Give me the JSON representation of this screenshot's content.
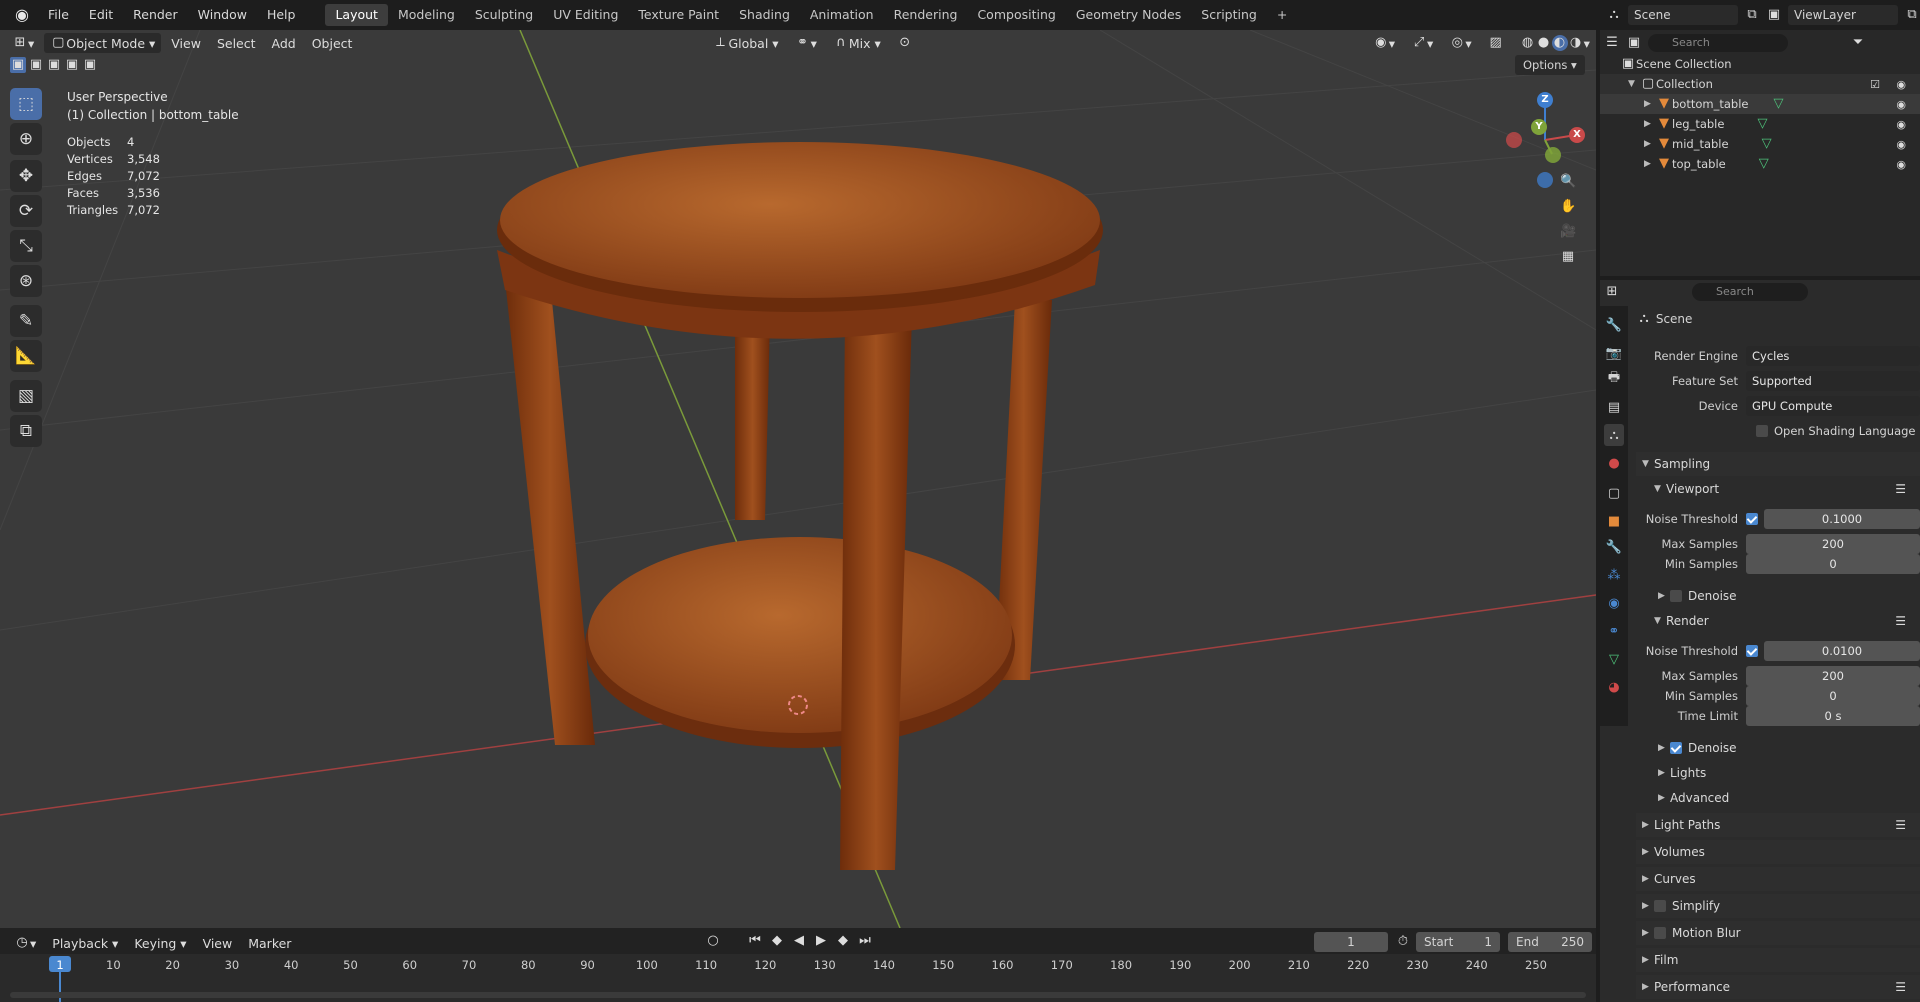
{
  "menu": [
    "File",
    "Edit",
    "Render",
    "Window",
    "Help"
  ],
  "workspaces": [
    "Layout",
    "Modeling",
    "Sculpting",
    "UV Editing",
    "Texture Paint",
    "Shading",
    "Animation",
    "Rendering",
    "Compositing",
    "Geometry Nodes",
    "Scripting"
  ],
  "active_workspace": "Layout",
  "add_tab_icon": "plus-icon",
  "scene_name": "Scene",
  "view_layer": "ViewLayer",
  "viewport_header": {
    "mode": "Object Mode",
    "menus": [
      "View",
      "Select",
      "Add",
      "Object"
    ],
    "transform": "Global",
    "snap": "Mix",
    "options": "Options"
  },
  "viewport_info": {
    "perspective": "User Perspective",
    "collection": "(1) Collection | bottom_table",
    "stats": [
      {
        "k": "Objects",
        "v": "4"
      },
      {
        "k": "Vertices",
        "v": "3,548"
      },
      {
        "k": "Edges",
        "v": "7,072"
      },
      {
        "k": "Faces",
        "v": "3,536"
      },
      {
        "k": "Triangles",
        "v": "7,072"
      }
    ]
  },
  "gizmo": {
    "x": "X",
    "y": "Y",
    "z": "Z"
  },
  "outliner": {
    "search_placeholder": "Search",
    "root": "Scene Collection",
    "collection": "Collection",
    "objects": [
      "bottom_table",
      "leg_table",
      "mid_table",
      "top_table"
    ]
  },
  "properties": {
    "search_placeholder": "Search",
    "context": "Scene",
    "render_engine": {
      "label": "Render Engine",
      "value": "Cycles"
    },
    "feature_set": {
      "label": "Feature Set",
      "value": "Supported"
    },
    "device": {
      "label": "Device",
      "value": "GPU Compute"
    },
    "osl": "Open Shading Language",
    "sampling": "Sampling",
    "viewport": {
      "title": "Viewport",
      "noise_threshold_label": "Noise Threshold",
      "noise_threshold": "0.1000",
      "max_samples_label": "Max Samples",
      "max_samples": "200",
      "min_samples_label": "Min Samples",
      "min_samples": "0",
      "denoise": "Denoise"
    },
    "render": {
      "title": "Render",
      "noise_threshold_label": "Noise Threshold",
      "noise_threshold": "0.0100",
      "max_samples_label": "Max Samples",
      "max_samples": "200",
      "min_samples_label": "Min Samples",
      "min_samples": "0",
      "time_limit_label": "Time Limit",
      "time_limit": "0 s",
      "denoise": "Denoise"
    },
    "lights": "Lights",
    "advanced": "Advanced",
    "panels": [
      "Light Paths",
      "Volumes",
      "Curves",
      "Simplify",
      "Motion Blur",
      "Film",
      "Performance"
    ]
  },
  "timeline": {
    "menus": [
      "Playback",
      "Keying",
      "View",
      "Marker"
    ],
    "current_frame": "1",
    "start_label": "Start",
    "start": "1",
    "end_label": "End",
    "end": "250",
    "ticks": [
      "1",
      "10",
      "20",
      "30",
      "40",
      "50",
      "60",
      "70",
      "80",
      "90",
      "100",
      "110",
      "120",
      "130",
      "140",
      "150",
      "160",
      "170",
      "180",
      "190",
      "200",
      "210",
      "220",
      "230",
      "240",
      "250"
    ]
  },
  "colors": {
    "accent": "#4a88d0",
    "wood": "#8a3f14",
    "x_axis": "#c94a4a",
    "y_axis": "#7fa33a",
    "z_axis": "#3f7fd0"
  }
}
